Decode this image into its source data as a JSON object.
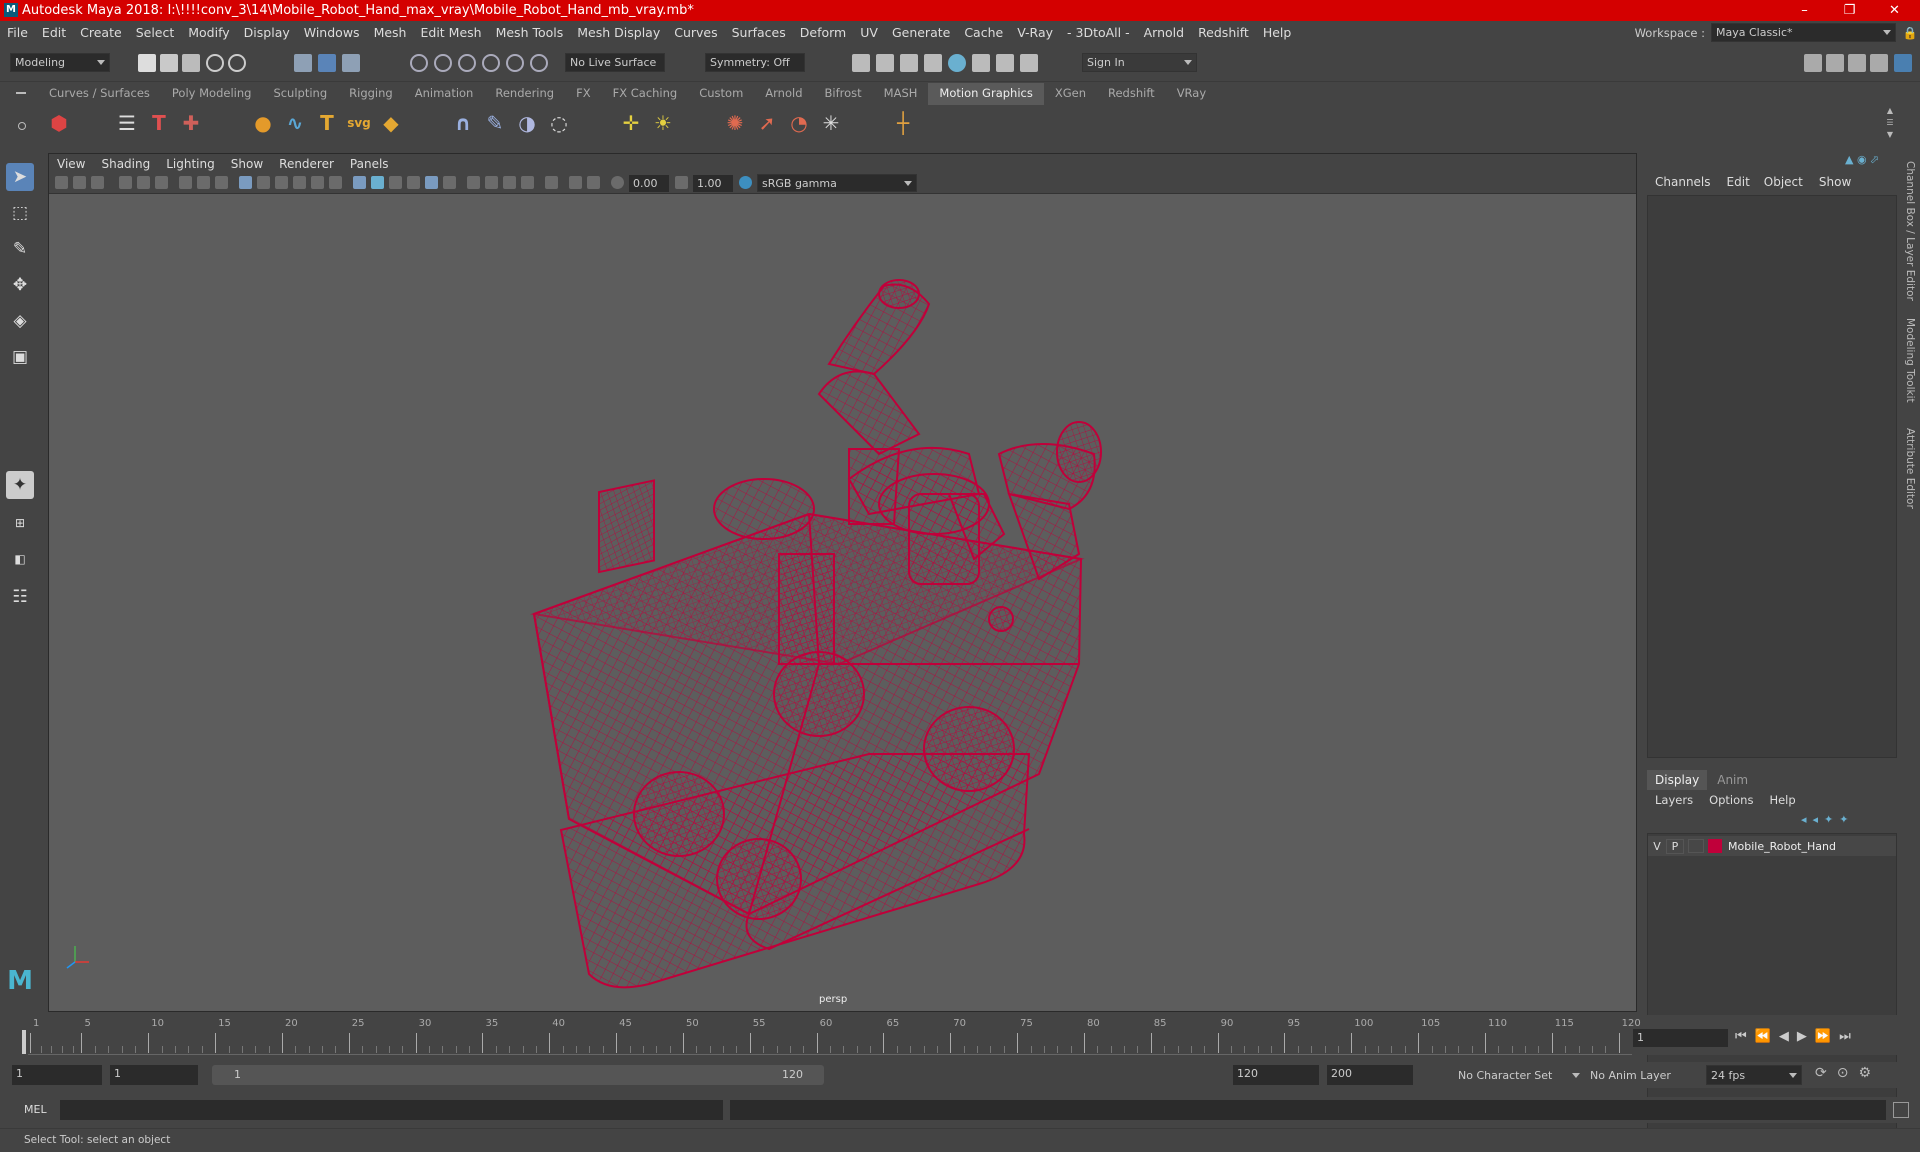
{
  "titlebar": {
    "title": "Autodesk Maya 2018: I:\\!!!!conv_3\\14\\Mobile_Robot_Hand_max_vray\\Mobile_Robot_Hand_mb_vray.mb*",
    "minimize": "–",
    "maximize": "❐",
    "close": "✕"
  },
  "menubar": {
    "items": [
      "File",
      "Edit",
      "Create",
      "Select",
      "Modify",
      "Display",
      "Windows",
      "Mesh",
      "Edit Mesh",
      "Mesh Tools",
      "Mesh Display",
      "Curves",
      "Surfaces",
      "Deform",
      "UV",
      "Generate",
      "Cache",
      "V-Ray",
      "- 3DtoAll -",
      "Arnold",
      "Redshift",
      "Help"
    ],
    "workspace_label": "Workspace :",
    "workspace_value": "Maya Classic*"
  },
  "statusline": {
    "mode": "Modeling",
    "live_surface": "No Live Surface",
    "symmetry": "Symmetry: Off",
    "sign_in": "Sign In"
  },
  "shelf": {
    "tabs": [
      "Curves / Surfaces",
      "Poly Modeling",
      "Sculpting",
      "Rigging",
      "Animation",
      "Rendering",
      "FX",
      "FX Caching",
      "Custom",
      "Arnold",
      "Bifrost",
      "MASH",
      "Motion Graphics",
      "XGen",
      "Redshift",
      "VRay"
    ],
    "active_tab": "Motion Graphics"
  },
  "viewport": {
    "menus": [
      "View",
      "Shading",
      "Lighting",
      "Show",
      "Renderer",
      "Panels"
    ],
    "exposure": "0.00",
    "gamma": "1.00",
    "color_space": "sRGB gamma",
    "camera": "persp"
  },
  "channelbox": {
    "menus": [
      "Channels",
      "Edit",
      "Object",
      "Show"
    ]
  },
  "layers": {
    "tabs": [
      "Display",
      "Anim"
    ],
    "active_tab": "Display",
    "menus": [
      "Layers",
      "Options",
      "Help"
    ],
    "layer": {
      "v": "V",
      "p": "P",
      "name": "Mobile_Robot_Hand",
      "color": "#c0003a"
    }
  },
  "sidetabs": [
    "Channel Box / Layer Editor",
    "Modeling Toolkit",
    "Attribute Editor"
  ],
  "timeline": {
    "ticks": [
      "1",
      "5",
      "10",
      "15",
      "20",
      "25",
      "30",
      "35",
      "40",
      "45",
      "50",
      "55",
      "60",
      "65",
      "70",
      "75",
      "80",
      "85",
      "90",
      "95",
      "100",
      "105",
      "110",
      "115",
      "120"
    ],
    "current_frame": "1"
  },
  "range": {
    "start": "1",
    "playback_start": "1",
    "slider_start": "1",
    "slider_end": "120",
    "playback_end": "120",
    "end": "200",
    "character_set": "No Character Set",
    "anim_layer": "No Anim Layer",
    "fps": "24 fps"
  },
  "cmd": {
    "label": "MEL"
  },
  "help": {
    "text": "Select Tool: select an object"
  },
  "colors": {
    "titlebar": "#d40000",
    "wireframe": "#c0003a",
    "bg": "#444444",
    "viewport": "#5d5d5d"
  }
}
